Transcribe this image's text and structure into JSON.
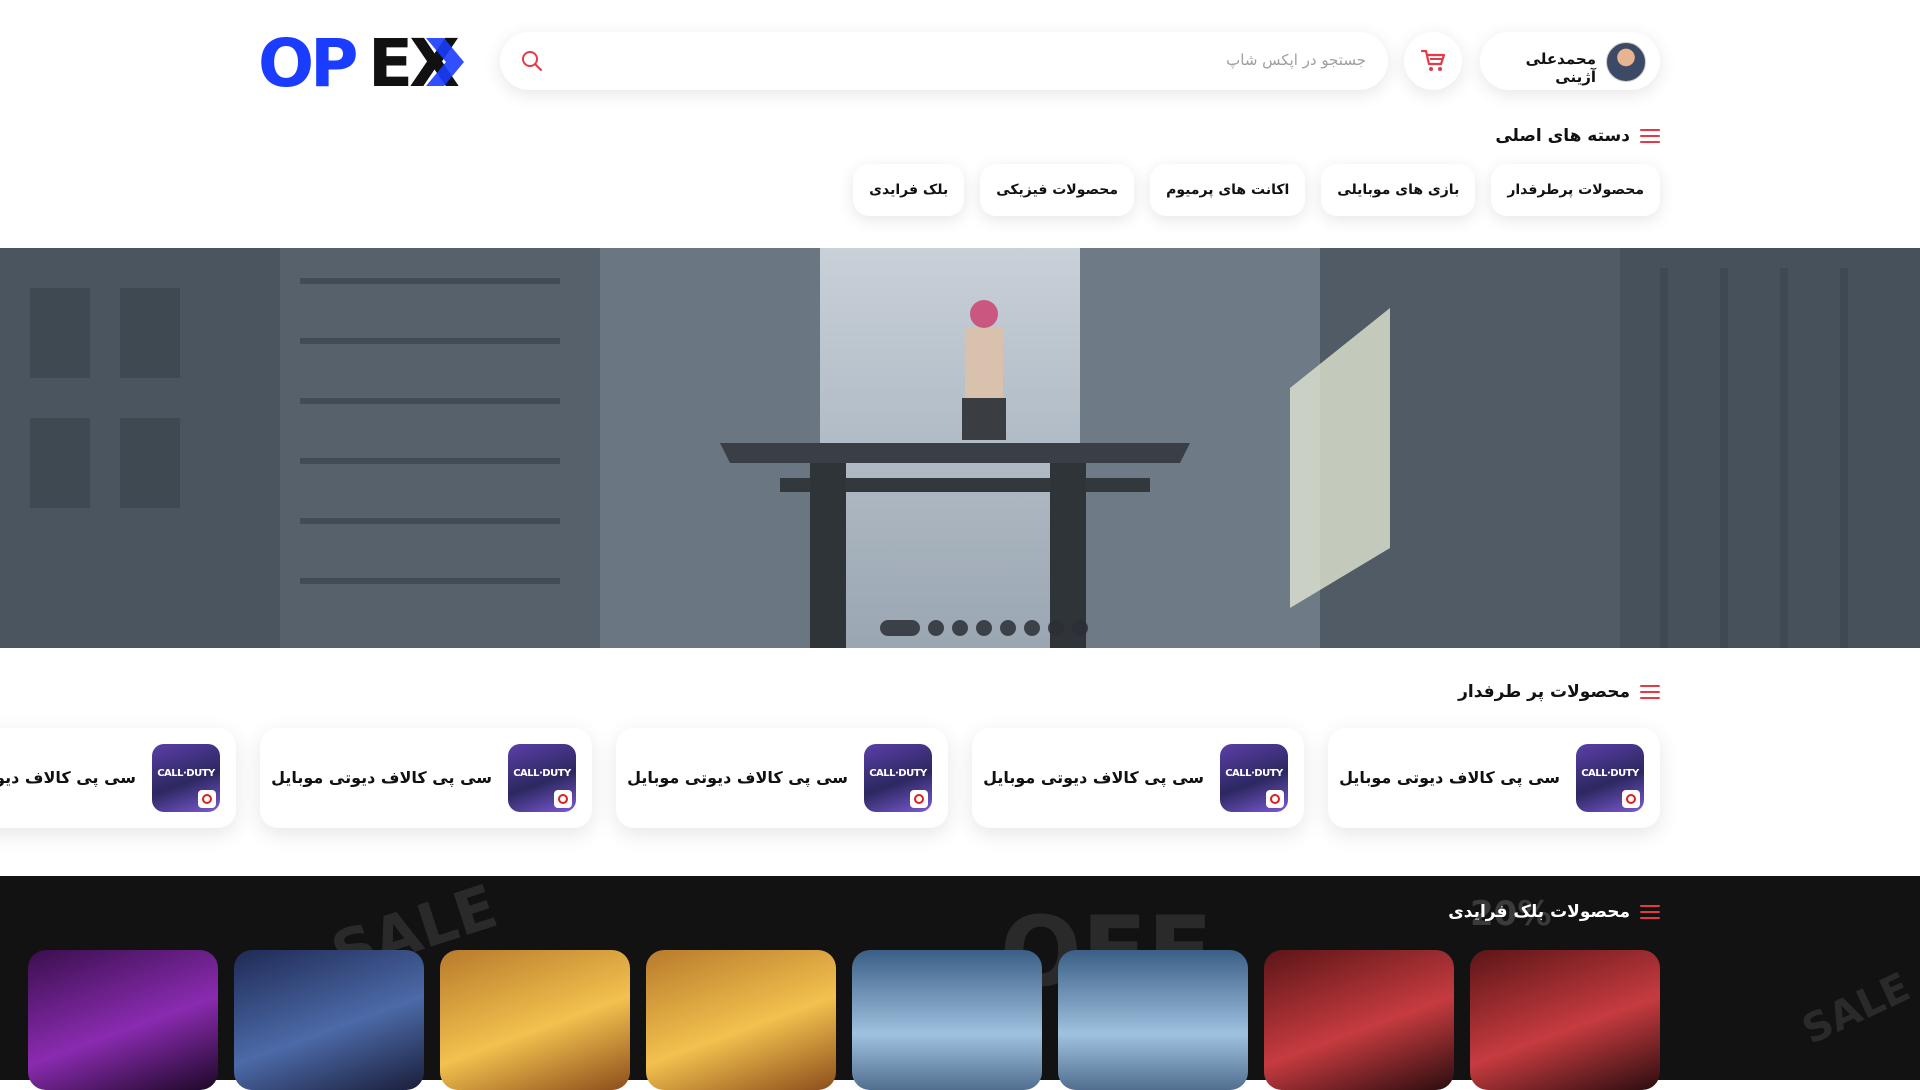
{
  "header": {
    "logo_text": "OPEX",
    "search_placeholder": "جستجو در اپکس شاپ",
    "user_name": "محمدعلی آژینی"
  },
  "categories": {
    "title": "دسته های اصلی",
    "items": [
      "محصولات پرطرفدار",
      "بازی های موبایلی",
      "اکانت های پرمیوم",
      "محصولات فیزیکی",
      "بلک فرایدی"
    ]
  },
  "hero": {
    "slide_count": 8,
    "active_slide": 1
  },
  "popular": {
    "title": "محصولات پر طرفدار",
    "product_name": "سی پی کالاف دیوتی موبایل",
    "thumb_text": "CALL·DUTY"
  },
  "black_friday": {
    "title": "محصولات بلک فرایدی",
    "decor": [
      "SALE",
      "OFF",
      "20%",
      "SALE"
    ]
  },
  "colors": {
    "brand_blue": "#1a3cff",
    "accent_red": "#e63946",
    "dark": "#121212"
  },
  "icons": [
    "search-icon",
    "cart-icon",
    "menu-icon"
  ]
}
